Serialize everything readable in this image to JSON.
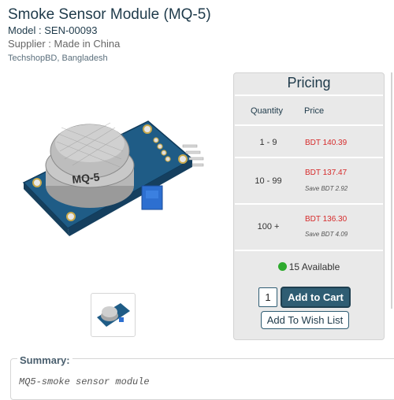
{
  "product": {
    "title": "Smoke Sensor Module (MQ-5)",
    "model": "Model : SEN-00093",
    "supplier": "Supplier : Made in China",
    "vendor": "TechshopBD, Bangladesh",
    "image_label": "MQ-5"
  },
  "pricing": {
    "title": "Pricing",
    "quantity_header": "Quantity",
    "price_header": "Price",
    "tiers": [
      {
        "qty": "1 - 9",
        "price": "BDT 140.39",
        "save": ""
      },
      {
        "qty": "10 - 99",
        "price": "BDT 137.47",
        "save": "Save BDT 2.92"
      },
      {
        "qty": "100 +",
        "price": "BDT 136.30",
        "save": "Save BDT 4.09"
      }
    ],
    "availability": "15 Available",
    "quantity_value": "1",
    "add_to_cart": "Add to Cart",
    "add_to_wishlist": "Add To Wish List"
  },
  "summary": {
    "label": "Summary:",
    "text": "MQ5-smoke sensor module"
  },
  "colors": {
    "accent": "#2f5d73",
    "price_red": "#d62a2a",
    "available_green": "#2eaa2e",
    "panel_bg": "#e9e9e9"
  }
}
